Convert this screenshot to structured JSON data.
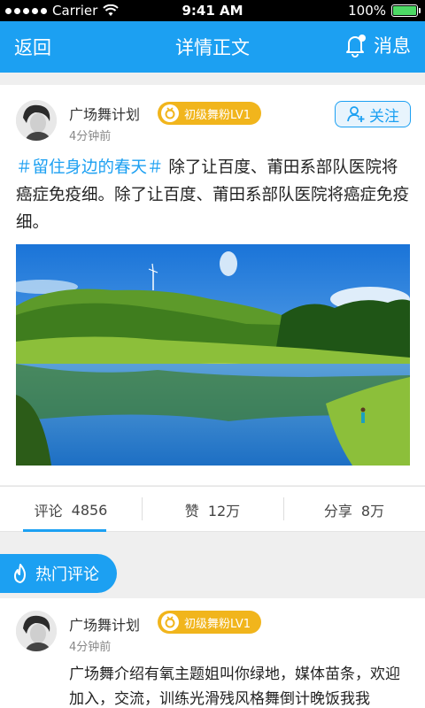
{
  "status_bar": {
    "carrier": "Carrier",
    "time": "9:41 AM",
    "battery": "100%",
    "battery_level": 1.0
  },
  "nav": {
    "back": "返回",
    "title": "详情正文",
    "message": "消息"
  },
  "post": {
    "user_name": "广场舞计划",
    "badge": "初级舞粉LV1",
    "time": "4分钟前",
    "follow_label": "关注",
    "hashtag": "＃留住身边的春天＃",
    "body": " 除了让百度、莆田系部队医院将癌症免疫细。除了让百度、莆田系部队医院将癌症免疫细。",
    "image": "lake-landscape-photo"
  },
  "stats": {
    "comments_label": "评论",
    "comments_count": "4856",
    "likes_label": "赞",
    "likes_count": "12万",
    "shares_label": "分享",
    "shares_count": "8万"
  },
  "hot_comments": {
    "title": "热门评论"
  },
  "comment": {
    "user_name": "广场舞计划",
    "badge": "初级舞粉LV1",
    "time": "4分钟前",
    "text": "广场舞介绍有氧主题姐叫你绿地，媒体苗条，欢迎加入，交流，训练光滑残风格舞倒计晚饭我我"
  },
  "colors": {
    "primary": "#1ca0f2",
    "badge": "#f1b51c"
  }
}
